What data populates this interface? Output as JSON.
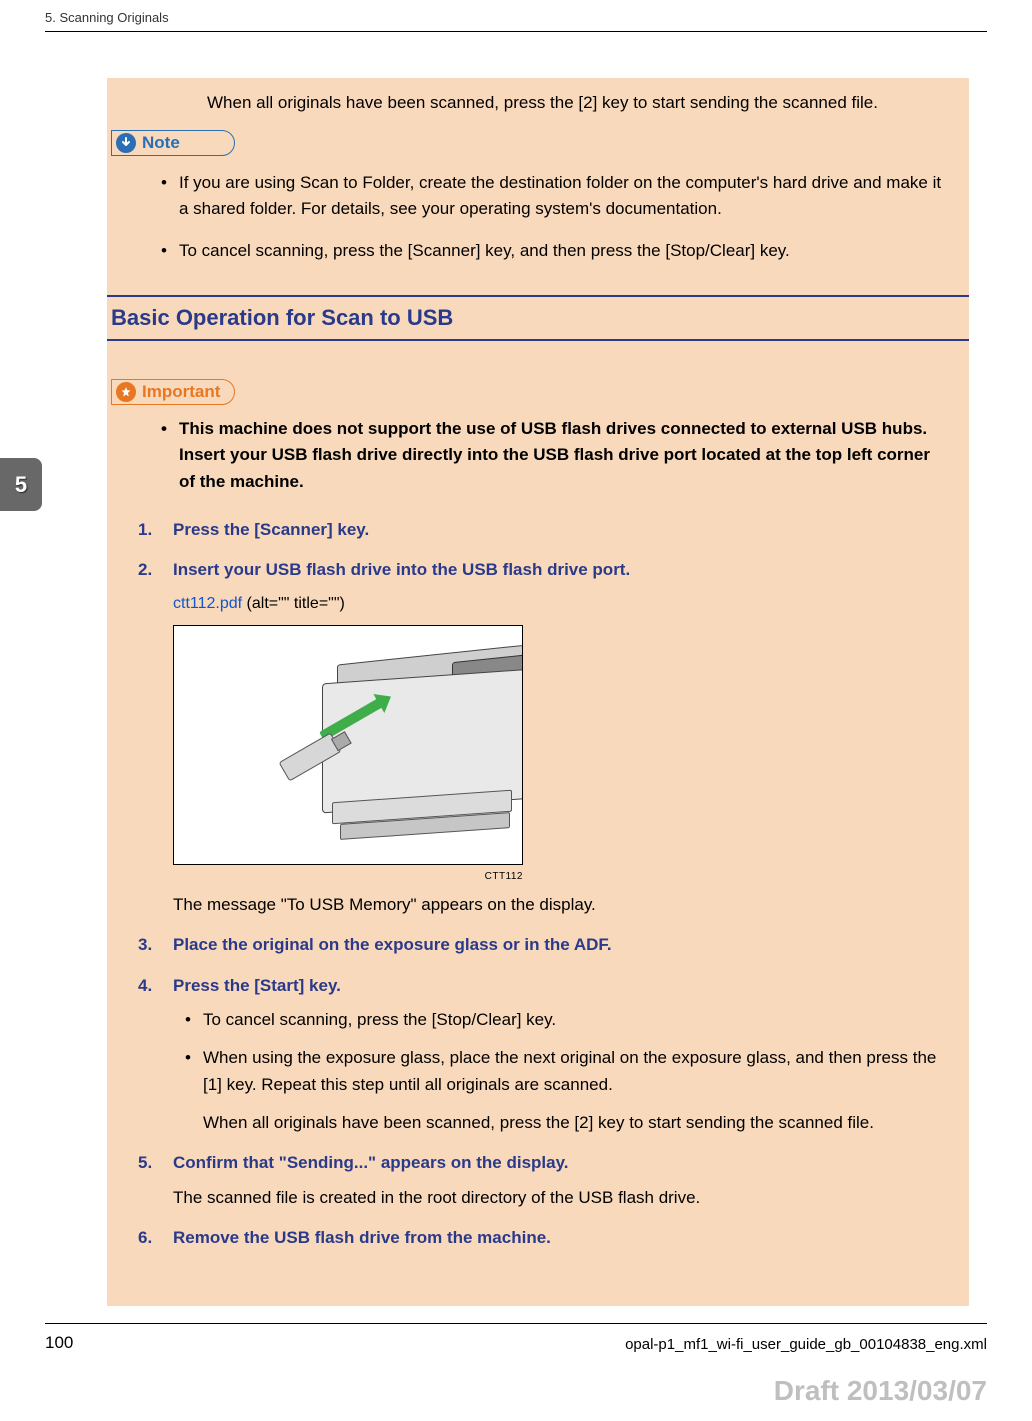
{
  "running_head": "5. Scanning Originals",
  "side_tab": "5",
  "intro_continuation": "When all originals have been scanned, press the [2] key to start sending the scanned file.",
  "note": {
    "label": "Note",
    "items": [
      "If you are using Scan to Folder, create the destination folder on the computer's hard drive and make it a shared folder. For details, see your operating system's documentation.",
      "To cancel scanning, press the [Scanner] key, and then press the [Stop/Clear] key."
    ]
  },
  "section": {
    "title": "Basic Operation for Scan to USB",
    "important": {
      "label": "Important",
      "items": [
        "This machine does not support the use of USB flash drives connected to external USB hubs. Insert your USB flash drive directly into the USB flash drive port located at the top left corner of the machine."
      ]
    },
    "steps": {
      "s1_title": "Press the [Scanner] key.",
      "s2_title": "Insert your USB flash drive into the USB flash drive port.",
      "s2_link": "ctt112.pdf",
      "s2_meta": " (alt=\"\" title=\"\")",
      "s2_fig_caption": "CTT112",
      "s2_after": "The message \"To USB Memory\" appears on the display.",
      "s3_title": "Place the original on the exposure glass or in the ADF.",
      "s4_title": "Press the [Start] key.",
      "s4_b1": "To cancel scanning, press the [Stop/Clear] key.",
      "s4_b2": "When using the exposure glass, place the next original on the exposure glass, and then press the [1] key. Repeat this step until all originals are scanned.",
      "s4_after": "When all originals have been scanned, press the [2] key to start sending the scanned file.",
      "s5_title": "Confirm that \"Sending...\" appears on the display.",
      "s5_detail": "The scanned file is created in the root directory of the USB flash drive.",
      "s6_title": "Remove the USB flash drive from the machine."
    }
  },
  "footer": {
    "page": "100",
    "path": "opal-p1_mf1_wi-fi_user_guide_gb_00104838_eng.xml"
  },
  "draft": "Draft 2013/03/07"
}
